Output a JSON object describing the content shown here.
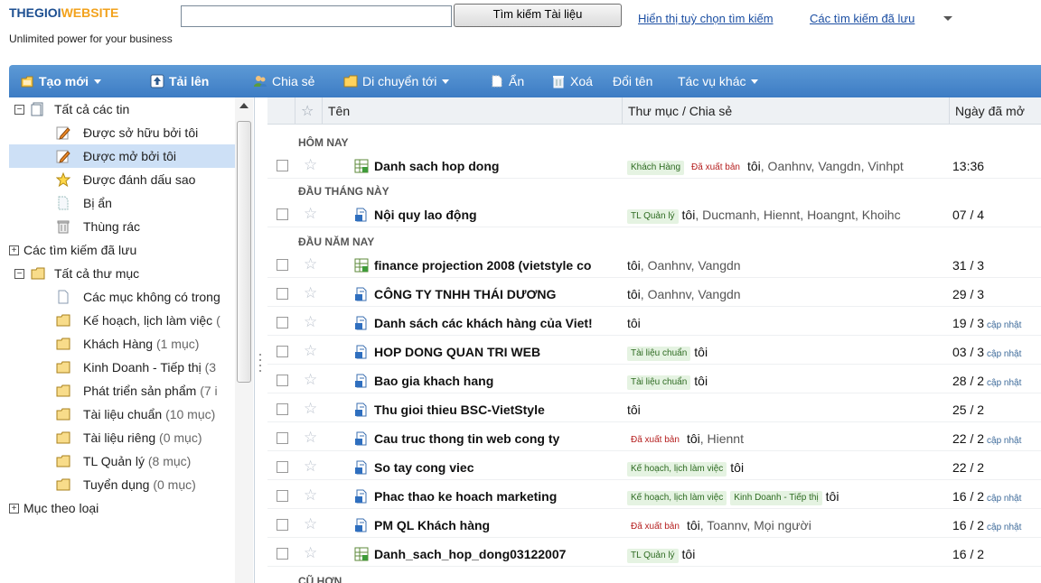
{
  "header": {
    "logo_part1": "THEGIOI",
    "logo_part2": "WEBSITE",
    "tagline": "Unlimited power for your business",
    "search_value": "",
    "search_button": "Tìm kiếm Tài liệu",
    "show_options_link": "Hiển thị tuỳ chọn tìm kiếm",
    "saved_searches_link": "Các tìm kiếm đã lưu"
  },
  "toolbar": {
    "new": "Tạo mới",
    "upload": "Tải lên",
    "share": "Chia sẻ",
    "move_to": "Di chuyển tới",
    "hide": "Ẩn",
    "delete": "Xoá",
    "rename": "Đổi tên",
    "more_actions": "Tác vụ khác"
  },
  "sidebar": {
    "all_items": "Tất cả các tin",
    "owned_by_me": "Được sở hữu bởi tôi",
    "opened_by_me": "Được mở bởi tôi",
    "starred": "Được đánh dấu sao",
    "hidden": "Bị ẩn",
    "trash": "Thùng rác",
    "saved_searches": "Các tìm kiếm đã lưu",
    "all_folders": "Tất cả thư mục",
    "folders": [
      {
        "name": "Các mục không có trong",
        "count": ""
      },
      {
        "name": "Kế hoạch, lịch làm việc",
        "count": "("
      },
      {
        "name": "Khách Hàng",
        "count": "(1 mục)"
      },
      {
        "name": "Kinh Doanh - Tiếp thị",
        "count": "(3"
      },
      {
        "name": "Phát triển sản phẩm",
        "count": "(7 i"
      },
      {
        "name": "Tài liệu chuẩn",
        "count": "(10 mục)"
      },
      {
        "name": "Tài liệu riêng",
        "count": "(0 mục)"
      },
      {
        "name": "TL Quản lý",
        "count": "(8 mục)"
      },
      {
        "name": "Tuyển dụng",
        "count": "(0 mục)"
      }
    ],
    "by_type": "Mục theo loại"
  },
  "columns": {
    "name": "Tên",
    "folder_share": "Thư mục / Chia sẻ",
    "date_opened": "Ngày đã mở"
  },
  "groups": {
    "today": "HÔM NAY",
    "this_month": "ĐẦU THÁNG NÀY",
    "this_year": "ĐẦU NĂM NAY",
    "older": "CŨ HƠN"
  },
  "rows": [
    {
      "name": "Danh sach hop dong",
      "icon": "spreadsheet-icon",
      "tags": [
        {
          "t": "Khách Hàng",
          "k": "g"
        },
        {
          "t": "Đã xuất bản",
          "k": "r"
        }
      ],
      "me": "tôi",
      "others": ", Oanhnv, Vangdn, Vinhpt",
      "date": "13:36",
      "updated": ""
    },
    {
      "name": "Nội quy lao động",
      "icon": "document-icon",
      "tags": [
        {
          "t": "TL Quản lý",
          "k": "g"
        }
      ],
      "me": "tôi",
      "others": ", Ducmanh, Hiennt, Hoangnt, Khoihc",
      "date": "07 / 4",
      "updated": ""
    },
    {
      "name": "finance projection 2008 (vietstyle co",
      "icon": "spreadsheet-icon",
      "tags": [],
      "me": "tôi",
      "others": ", Oanhnv, Vangdn",
      "date": "31 / 3",
      "updated": ""
    },
    {
      "name": "CÔNG TY TNHH THÁI DƯƠNG",
      "icon": "document-icon",
      "tags": [],
      "me": "tôi",
      "others": ", Oanhnv, Vangdn",
      "date": "29 / 3",
      "updated": ""
    },
    {
      "name": "Danh sách các khách hàng của Viet!",
      "icon": "document-icon",
      "tags": [],
      "me": "tôi",
      "others": "",
      "date": "19 / 3",
      "updated": "cập nhật"
    },
    {
      "name": "HOP DONG QUAN TRI WEB",
      "icon": "document-icon",
      "tags": [
        {
          "t": "Tài liệu chuẩn",
          "k": "g"
        }
      ],
      "me": "tôi",
      "others": "",
      "date": "03 / 3",
      "updated": "cập nhật"
    },
    {
      "name": "Bao gia khach hang",
      "icon": "document-icon",
      "tags": [
        {
          "t": "Tài liệu chuẩn",
          "k": "g"
        }
      ],
      "me": "tôi",
      "others": "",
      "date": "28 / 2",
      "updated": "cập nhật"
    },
    {
      "name": "Thu gioi thieu BSC-VietStyle",
      "icon": "document-icon",
      "tags": [],
      "me": "tôi",
      "others": "",
      "date": "25 / 2",
      "updated": ""
    },
    {
      "name": "Cau truc thong tin web cong ty",
      "icon": "document-icon",
      "tags": [
        {
          "t": "Đã xuất bản",
          "k": "r"
        }
      ],
      "me": "tôi",
      "others": ", Hiennt",
      "date": "22 / 2",
      "updated": "cập nhật"
    },
    {
      "name": "So tay cong viec",
      "icon": "document-icon",
      "tags": [
        {
          "t": "Kế hoạch, lịch làm việc",
          "k": "g"
        }
      ],
      "me": "tôi",
      "others": "",
      "date": "22 / 2",
      "updated": ""
    },
    {
      "name": "Phac thao ke hoach marketing",
      "icon": "document-icon",
      "tags": [
        {
          "t": "Kế hoạch, lịch làm việc",
          "k": "g"
        },
        {
          "t": "Kinh Doanh - Tiếp thị",
          "k": "g"
        }
      ],
      "me": "tôi",
      "others": "",
      "date": "16 / 2",
      "updated": "cập nhật"
    },
    {
      "name": "PM QL Khách hàng",
      "icon": "document-icon",
      "tags": [
        {
          "t": "Đã xuất bản",
          "k": "r"
        }
      ],
      "me": "tôi",
      "others": ", Toannv, Mọi người",
      "date": "16 / 2",
      "updated": "cập nhật"
    },
    {
      "name": "Danh_sach_hop_dong03122007",
      "icon": "spreadsheet-icon",
      "tags": [
        {
          "t": "TL Quản lý",
          "k": "g"
        }
      ],
      "me": "tôi",
      "others": "",
      "date": "16 / 2",
      "updated": ""
    }
  ],
  "colors": {
    "toolbar_top": "#5d9ad6",
    "toolbar_bottom": "#3d7cc4",
    "selected_row": "#cde0f6",
    "link": "#1c4fa3",
    "tag_green_bg": "#e5f3e2",
    "tag_red_text": "#b51e1e"
  }
}
